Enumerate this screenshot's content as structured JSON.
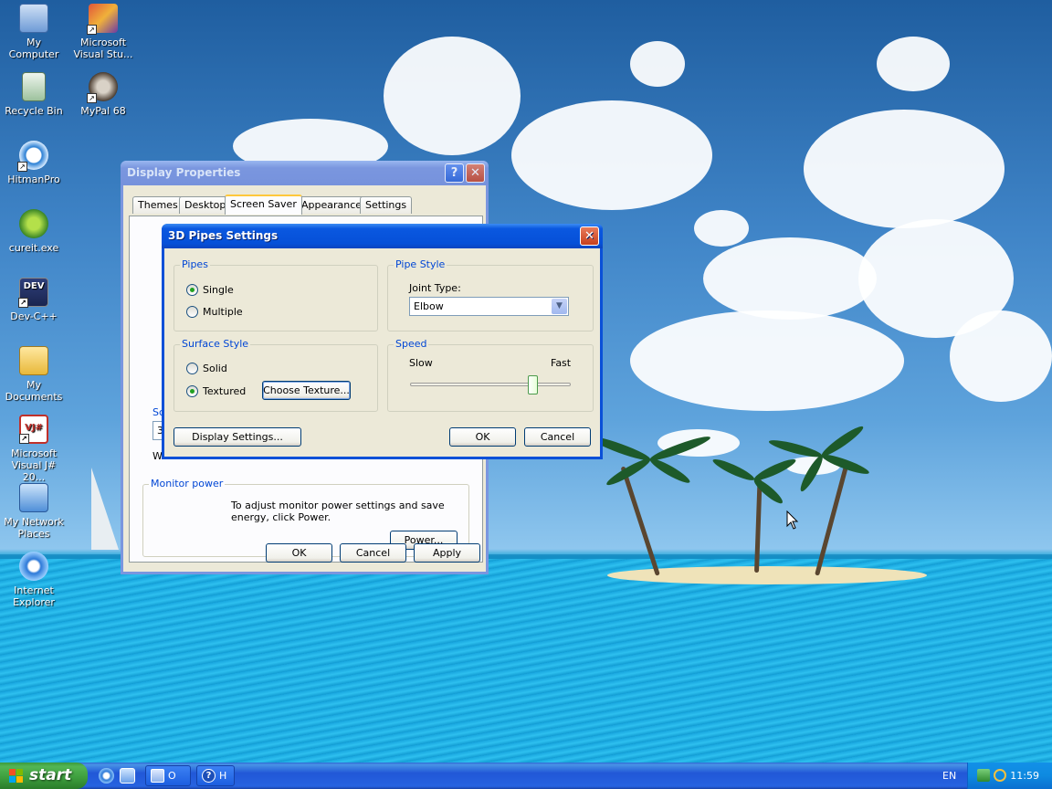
{
  "desktop_icons": [
    {
      "label": "My Computer"
    },
    {
      "label": "Microsoft Visual Stu..."
    },
    {
      "label": "Recycle Bin"
    },
    {
      "label": "MyPal 68"
    },
    {
      "label": "HitmanPro"
    },
    {
      "label": "cureit.exe"
    },
    {
      "label": "Dev-C++"
    },
    {
      "label": "My Documents"
    },
    {
      "label": "Microsoft Visual J# 20..."
    },
    {
      "label": "My Network Places"
    },
    {
      "label": "Internet Explorer"
    }
  ],
  "display_properties": {
    "title": "Display Properties",
    "tabs": [
      "Themes",
      "Desktop",
      "Screen Saver",
      "Appearance",
      "Settings"
    ],
    "active_tab": "Screen Saver",
    "screensaver_label_partial": "Sc",
    "screensaver_value_partial": "3D",
    "wait_partial": "W",
    "monitor_power": {
      "label": "Monitor power",
      "text": "To adjust monitor power settings and save energy, click Power.",
      "power_button": "Power..."
    },
    "buttons": {
      "ok": "OK",
      "cancel": "Cancel",
      "apply": "Apply"
    },
    "help_glyph": "?",
    "close_glyph": "✕"
  },
  "pipes_settings": {
    "title": "3D Pipes Settings",
    "close_glyph": "✕",
    "pipes": {
      "label": "Pipes",
      "options": [
        "Single",
        "Multiple"
      ],
      "selected": "Single"
    },
    "pipe_style": {
      "label": "Pipe Style",
      "joint_label": "Joint Type:",
      "joint_value": "Elbow"
    },
    "surface_style": {
      "label": "Surface Style",
      "options": [
        "Solid",
        "Textured"
      ],
      "selected": "Textured",
      "choose_texture": "Choose Texture..."
    },
    "speed": {
      "label": "Speed",
      "slow": "Slow",
      "fast": "Fast",
      "value_fraction": 0.78
    },
    "buttons": {
      "display_settings": "Display Settings...",
      "ok": "OK",
      "cancel": "Cancel"
    }
  },
  "taskbar": {
    "start_label": "start",
    "tasks": [
      {
        "label": "O"
      },
      {
        "label": "H"
      }
    ],
    "language": "EN",
    "clock": "11:59"
  },
  "colors": {
    "xp_blue": "#0a50d8",
    "window_face": "#ece9d8",
    "group_label": "#0046d5",
    "start_green": "#3c9a3c"
  }
}
